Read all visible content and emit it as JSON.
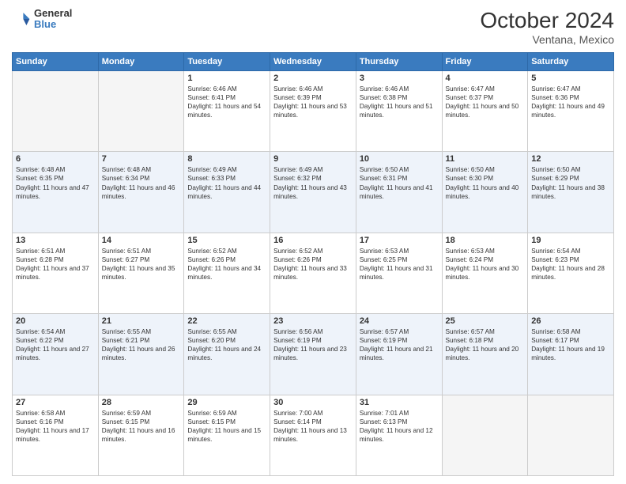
{
  "header": {
    "logo": {
      "line1": "General",
      "line2": "Blue"
    },
    "title": "October 2024",
    "location": "Ventana, Mexico"
  },
  "weekdays": [
    "Sunday",
    "Monday",
    "Tuesday",
    "Wednesday",
    "Thursday",
    "Friday",
    "Saturday"
  ],
  "weeks": [
    [
      {
        "day": "",
        "empty": true
      },
      {
        "day": "",
        "empty": true
      },
      {
        "day": "1",
        "sunrise": "6:46 AM",
        "sunset": "6:41 PM",
        "daylight": "11 hours and 54 minutes."
      },
      {
        "day": "2",
        "sunrise": "6:46 AM",
        "sunset": "6:39 PM",
        "daylight": "11 hours and 53 minutes."
      },
      {
        "day": "3",
        "sunrise": "6:46 AM",
        "sunset": "6:38 PM",
        "daylight": "11 hours and 51 minutes."
      },
      {
        "day": "4",
        "sunrise": "6:47 AM",
        "sunset": "6:37 PM",
        "daylight": "11 hours and 50 minutes."
      },
      {
        "day": "5",
        "sunrise": "6:47 AM",
        "sunset": "6:36 PM",
        "daylight": "11 hours and 49 minutes."
      }
    ],
    [
      {
        "day": "6",
        "sunrise": "6:48 AM",
        "sunset": "6:35 PM",
        "daylight": "11 hours and 47 minutes."
      },
      {
        "day": "7",
        "sunrise": "6:48 AM",
        "sunset": "6:34 PM",
        "daylight": "11 hours and 46 minutes."
      },
      {
        "day": "8",
        "sunrise": "6:49 AM",
        "sunset": "6:33 PM",
        "daylight": "11 hours and 44 minutes."
      },
      {
        "day": "9",
        "sunrise": "6:49 AM",
        "sunset": "6:32 PM",
        "daylight": "11 hours and 43 minutes."
      },
      {
        "day": "10",
        "sunrise": "6:50 AM",
        "sunset": "6:31 PM",
        "daylight": "11 hours and 41 minutes."
      },
      {
        "day": "11",
        "sunrise": "6:50 AM",
        "sunset": "6:30 PM",
        "daylight": "11 hours and 40 minutes."
      },
      {
        "day": "12",
        "sunrise": "6:50 AM",
        "sunset": "6:29 PM",
        "daylight": "11 hours and 38 minutes."
      }
    ],
    [
      {
        "day": "13",
        "sunrise": "6:51 AM",
        "sunset": "6:28 PM",
        "daylight": "11 hours and 37 minutes."
      },
      {
        "day": "14",
        "sunrise": "6:51 AM",
        "sunset": "6:27 PM",
        "daylight": "11 hours and 35 minutes."
      },
      {
        "day": "15",
        "sunrise": "6:52 AM",
        "sunset": "6:26 PM",
        "daylight": "11 hours and 34 minutes."
      },
      {
        "day": "16",
        "sunrise": "6:52 AM",
        "sunset": "6:26 PM",
        "daylight": "11 hours and 33 minutes."
      },
      {
        "day": "17",
        "sunrise": "6:53 AM",
        "sunset": "6:25 PM",
        "daylight": "11 hours and 31 minutes."
      },
      {
        "day": "18",
        "sunrise": "6:53 AM",
        "sunset": "6:24 PM",
        "daylight": "11 hours and 30 minutes."
      },
      {
        "day": "19",
        "sunrise": "6:54 AM",
        "sunset": "6:23 PM",
        "daylight": "11 hours and 28 minutes."
      }
    ],
    [
      {
        "day": "20",
        "sunrise": "6:54 AM",
        "sunset": "6:22 PM",
        "daylight": "11 hours and 27 minutes."
      },
      {
        "day": "21",
        "sunrise": "6:55 AM",
        "sunset": "6:21 PM",
        "daylight": "11 hours and 26 minutes."
      },
      {
        "day": "22",
        "sunrise": "6:55 AM",
        "sunset": "6:20 PM",
        "daylight": "11 hours and 24 minutes."
      },
      {
        "day": "23",
        "sunrise": "6:56 AM",
        "sunset": "6:19 PM",
        "daylight": "11 hours and 23 minutes."
      },
      {
        "day": "24",
        "sunrise": "6:57 AM",
        "sunset": "6:19 PM",
        "daylight": "11 hours and 21 minutes."
      },
      {
        "day": "25",
        "sunrise": "6:57 AM",
        "sunset": "6:18 PM",
        "daylight": "11 hours and 20 minutes."
      },
      {
        "day": "26",
        "sunrise": "6:58 AM",
        "sunset": "6:17 PM",
        "daylight": "11 hours and 19 minutes."
      }
    ],
    [
      {
        "day": "27",
        "sunrise": "6:58 AM",
        "sunset": "6:16 PM",
        "daylight": "11 hours and 17 minutes."
      },
      {
        "day": "28",
        "sunrise": "6:59 AM",
        "sunset": "6:15 PM",
        "daylight": "11 hours and 16 minutes."
      },
      {
        "day": "29",
        "sunrise": "6:59 AM",
        "sunset": "6:15 PM",
        "daylight": "11 hours and 15 minutes."
      },
      {
        "day": "30",
        "sunrise": "7:00 AM",
        "sunset": "6:14 PM",
        "daylight": "11 hours and 13 minutes."
      },
      {
        "day": "31",
        "sunrise": "7:01 AM",
        "sunset": "6:13 PM",
        "daylight": "11 hours and 12 minutes."
      },
      {
        "day": "",
        "empty": true
      },
      {
        "day": "",
        "empty": true
      }
    ]
  ],
  "labels": {
    "sunrise": "Sunrise:",
    "sunset": "Sunset:",
    "daylight": "Daylight:"
  }
}
